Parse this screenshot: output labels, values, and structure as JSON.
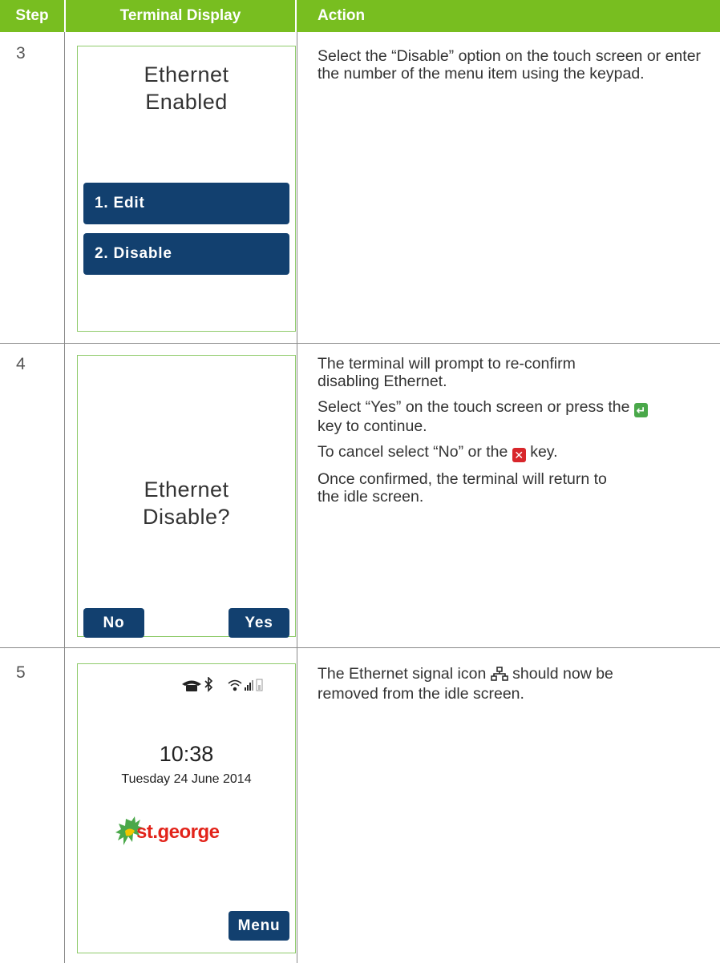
{
  "header": {
    "step": "Step",
    "display": "Terminal Display",
    "action": "Action"
  },
  "rows": [
    {
      "step": "3",
      "screen": {
        "title_line1": "Ethernet",
        "title_line2": "Enabled",
        "options": [
          "1. Edit",
          "2. Disable"
        ]
      },
      "action": [
        "Select the “Disable” option on the touch screen or enter the number of the menu item using the keypad."
      ]
    },
    {
      "step": "4",
      "screen": {
        "title_line1": "Ethernet",
        "title_line2": "Disable?",
        "no_button": "No",
        "yes_button": "Yes"
      },
      "action": {
        "p1": "The terminal will prompt to re-confirm disabling Ethernet.",
        "p2_a": "Select “Yes” on the touch screen or press the",
        "p2_b": "key to continue.",
        "p3_a": "To cancel select “No” or the",
        "p3_b": "key.",
        "p4": "Once confirmed, the terminal will return to the idle screen."
      }
    },
    {
      "step": "5",
      "screen": {
        "time": "10:38",
        "date": "Tuesday 24 June 2014",
        "logo_text": "st.george",
        "menu_button": "Menu"
      },
      "action": {
        "a": "The Ethernet signal icon",
        "b": "should now be removed from the idle screen."
      }
    }
  ],
  "icons": {
    "enter_key": "enter-key-icon",
    "cancel_key": "cancel-key-icon",
    "ethernet": "ethernet-icon",
    "phone": "phone-icon",
    "bluetooth": "bluetooth-icon",
    "wifi": "wifi-icon",
    "signal": "signal-icon",
    "battery": "battery-icon"
  },
  "colors": {
    "header_green": "#78be20",
    "button_navy": "#12406f",
    "screen_border": "#8fcb6b",
    "logo_red": "#e2231a",
    "logo_green": "#4aa84a"
  }
}
